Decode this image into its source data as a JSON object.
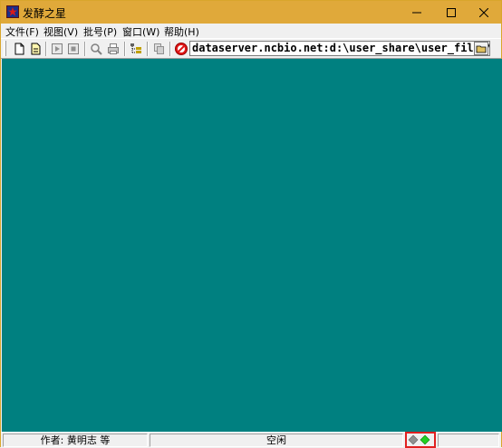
{
  "window": {
    "title": "发酵之星"
  },
  "title_buttons": {
    "minimize": "—",
    "maximize": "☐",
    "close": "✕"
  },
  "menu": {
    "items": [
      {
        "label": "文件(F)"
      },
      {
        "label": "视图(V)"
      },
      {
        "label": "批号(P)"
      },
      {
        "label": "窗口(W)"
      },
      {
        "label": "帮助(H)"
      }
    ]
  },
  "toolbar": {
    "address": "dataserver.ncbio.net:d:\\user_share\\user_files\\bi"
  },
  "status": {
    "author": "作者: 黄明志 等",
    "state": "空闲"
  },
  "colors": {
    "client": "#008080",
    "titlebar": "#e0a93a",
    "indicator_border": "#e02020"
  }
}
